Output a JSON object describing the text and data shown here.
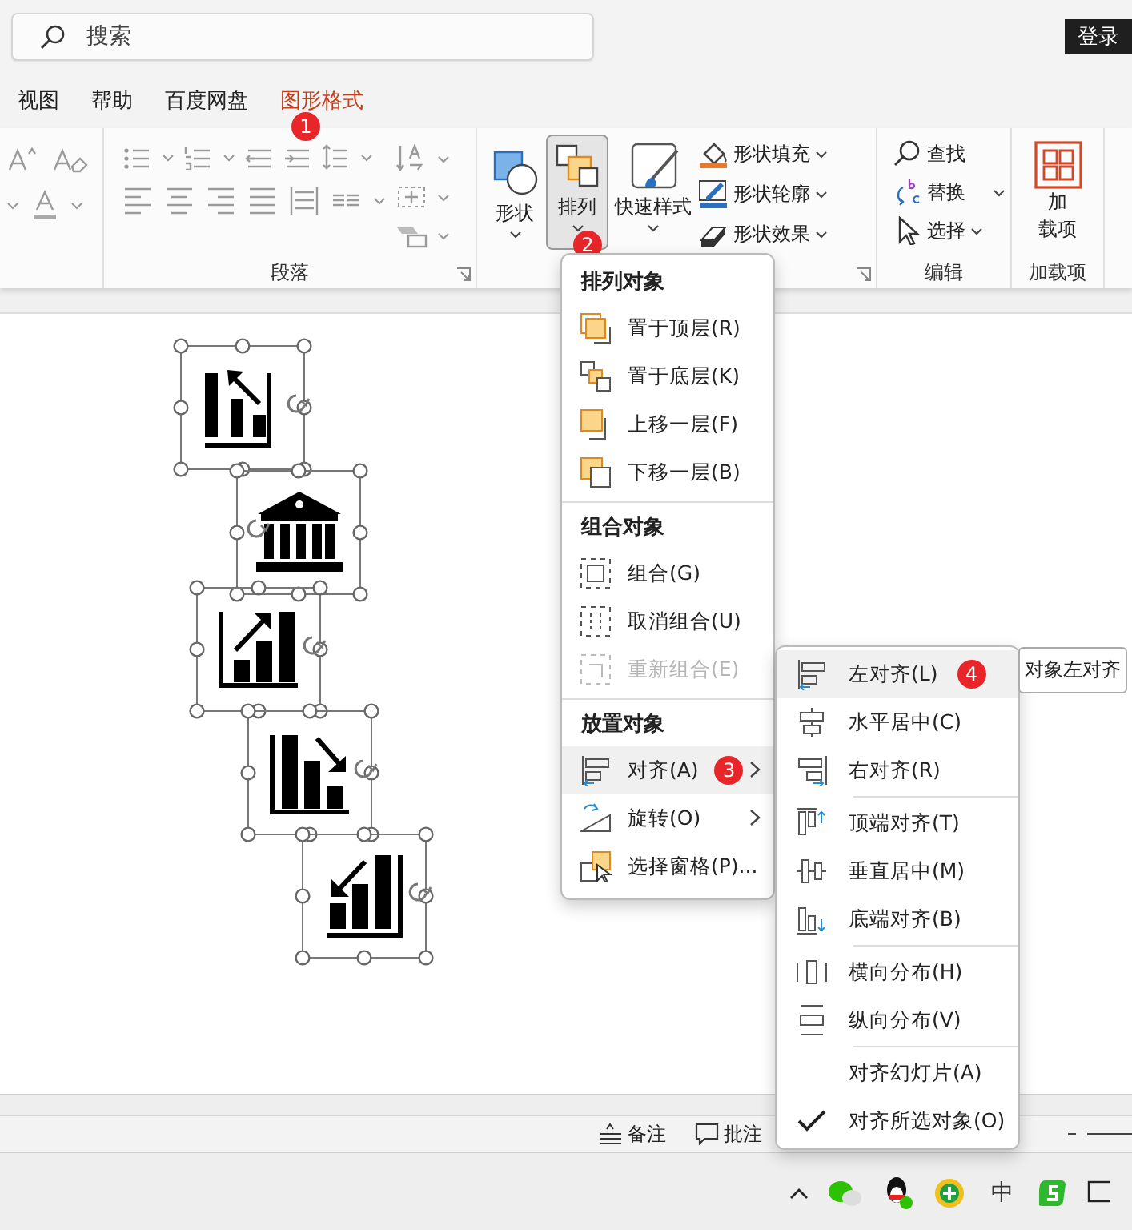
{
  "title_bar": {
    "search": {
      "placeholder": "搜索"
    },
    "login_button": "登录"
  },
  "menu_tabs": [
    {
      "label": "视图",
      "selected": false
    },
    {
      "label": "帮助",
      "selected": false
    },
    {
      "label": "百度网盘",
      "selected": false
    },
    {
      "label": "图形格式",
      "selected": true,
      "badge": "1"
    }
  ],
  "ribbon": {
    "paragraph_group": {
      "label": "段落"
    },
    "drawing_group": {
      "large_buttons": [
        {
          "label": "形状",
          "pressed": false
        },
        {
          "label": "排列",
          "pressed": true,
          "badge": "2"
        },
        {
          "label": "快速样式",
          "pressed": false
        }
      ],
      "small_buttons": [
        {
          "label": "形状填充"
        },
        {
          "label": "形状轮廓"
        },
        {
          "label": "形状效果"
        }
      ]
    },
    "editing_group": {
      "label": "编辑",
      "buttons": [
        {
          "label": "查找"
        },
        {
          "label": "替换"
        },
        {
          "label": "选择"
        }
      ]
    },
    "addins_group": {
      "label": "加载项",
      "button_lines": [
        "加",
        "载项"
      ]
    }
  },
  "slide": {
    "objects": [
      {
        "kind": "chart-up-left",
        "selected": true
      },
      {
        "kind": "bank",
        "selected": true
      },
      {
        "kind": "chart-up-right",
        "selected": true
      },
      {
        "kind": "chart-down-right",
        "selected": true
      },
      {
        "kind": "chart-down-left",
        "selected": true
      }
    ]
  },
  "arrange_menu": {
    "sections": [
      {
        "header": "排列对象",
        "items": [
          {
            "label": "置于顶层(R)",
            "disabled": false,
            "selected": false,
            "has_submenu": false
          },
          {
            "label": "置于底层(K)",
            "disabled": false,
            "selected": false,
            "has_submenu": false
          },
          {
            "label": "上移一层(F)",
            "disabled": false,
            "selected": false,
            "has_submenu": false
          },
          {
            "label": "下移一层(B)",
            "disabled": false,
            "selected": false,
            "has_submenu": false
          }
        ]
      },
      {
        "header": "组合对象",
        "items": [
          {
            "label": "组合(G)",
            "disabled": false,
            "selected": false,
            "has_submenu": false
          },
          {
            "label": "取消组合(U)",
            "disabled": false,
            "selected": false,
            "has_submenu": false
          },
          {
            "label": "重新组合(E)",
            "disabled": true,
            "selected": false,
            "has_submenu": false
          }
        ]
      },
      {
        "header": "放置对象",
        "items": [
          {
            "label": "对齐(A)",
            "disabled": false,
            "selected": true,
            "has_submenu": true,
            "badge": "3"
          },
          {
            "label": "旋转(O)",
            "disabled": false,
            "selected": false,
            "has_submenu": true
          },
          {
            "label": "选择窗格(P)...",
            "disabled": false,
            "selected": false,
            "has_submenu": false
          }
        ]
      }
    ]
  },
  "align_submenu": {
    "groups": [
      {
        "items": [
          {
            "label": "左对齐(L)",
            "selected": true,
            "checked": false,
            "badge": "4"
          },
          {
            "label": "水平居中(C)",
            "selected": false,
            "checked": false
          },
          {
            "label": "右对齐(R)",
            "selected": false,
            "checked": false
          }
        ]
      },
      {
        "items": [
          {
            "label": "顶端对齐(T)",
            "selected": false,
            "checked": false
          },
          {
            "label": "垂直居中(M)",
            "selected": false,
            "checked": false
          },
          {
            "label": "底端对齐(B)",
            "selected": false,
            "checked": false
          }
        ]
      },
      {
        "items": [
          {
            "label": "横向分布(H)",
            "selected": false,
            "checked": false
          },
          {
            "label": "纵向分布(V)",
            "selected": false,
            "checked": false
          }
        ]
      },
      {
        "items": [
          {
            "label": "对齐幻灯片(A)",
            "selected": false,
            "checked": false
          },
          {
            "label": "对齐所选对象(O)",
            "selected": false,
            "checked": true
          }
        ]
      }
    ]
  },
  "tooltip": "对象左对齐",
  "status_bar": {
    "items": [
      {
        "label": "备注"
      },
      {
        "label": "批注"
      }
    ]
  },
  "taskbar": {
    "input_indicator": "中"
  }
}
